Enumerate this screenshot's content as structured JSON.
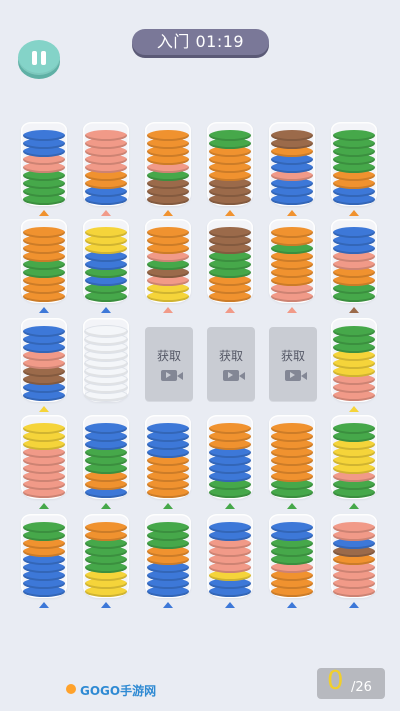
{
  "header": {
    "level_label": "入门 01:19"
  },
  "palette": {
    "blue": "#3d78d8",
    "salmon": "#f19a88",
    "orange": "#f0922f",
    "green": "#46a84a",
    "brown": "#9b6a4a",
    "yellow": "#f5d43a",
    "white": "#f4f6f9"
  },
  "tubes": [
    {
      "col": 0,
      "row": 0,
      "marker": "orange",
      "discs": [
        "blue",
        "blue",
        "blue",
        "salmon",
        "salmon",
        "green",
        "green",
        "green",
        "green"
      ]
    },
    {
      "col": 1,
      "row": 0,
      "marker": "salmon",
      "discs": [
        "salmon",
        "salmon",
        "salmon",
        "salmon",
        "salmon",
        "orange",
        "orange",
        "blue",
        "blue"
      ]
    },
    {
      "col": 2,
      "row": 0,
      "marker": "orange",
      "discs": [
        "orange",
        "orange",
        "orange",
        "orange",
        "salmon",
        "green",
        "brown",
        "brown",
        "brown"
      ]
    },
    {
      "col": 3,
      "row": 0,
      "marker": "orange",
      "discs": [
        "green",
        "green",
        "orange",
        "orange",
        "orange",
        "orange",
        "brown",
        "brown",
        "brown"
      ]
    },
    {
      "col": 4,
      "row": 0,
      "marker": "orange",
      "discs": [
        "brown",
        "brown",
        "orange",
        "blue",
        "blue",
        "salmon",
        "blue",
        "blue",
        "blue"
      ]
    },
    {
      "col": 5,
      "row": 0,
      "marker": "orange",
      "discs": [
        "green",
        "green",
        "green",
        "green",
        "green",
        "orange",
        "orange",
        "blue",
        "blue"
      ]
    },
    {
      "col": 0,
      "row": 1,
      "marker": "blue",
      "discs": [
        "orange",
        "orange",
        "orange",
        "orange",
        "green",
        "green",
        "orange",
        "orange",
        "orange"
      ]
    },
    {
      "col": 1,
      "row": 1,
      "marker": "blue",
      "discs": [
        "yellow",
        "yellow",
        "yellow",
        "blue",
        "blue",
        "green",
        "blue",
        "green",
        "green"
      ]
    },
    {
      "col": 2,
      "row": 1,
      "marker": "salmon",
      "discs": [
        "orange",
        "orange",
        "orange",
        "salmon",
        "green",
        "brown",
        "salmon",
        "yellow",
        "yellow"
      ]
    },
    {
      "col": 3,
      "row": 1,
      "marker": "salmon",
      "discs": [
        "brown",
        "brown",
        "brown",
        "green",
        "green",
        "green",
        "orange",
        "orange",
        "orange"
      ]
    },
    {
      "col": 4,
      "row": 1,
      "marker": "salmon",
      "discs": [
        "orange",
        "orange",
        "green",
        "orange",
        "orange",
        "orange",
        "orange",
        "salmon",
        "salmon"
      ]
    },
    {
      "col": 5,
      "row": 1,
      "marker": "brown",
      "discs": [
        "blue",
        "blue",
        "blue",
        "salmon",
        "salmon",
        "orange",
        "orange",
        "green",
        "green"
      ]
    },
    {
      "col": 0,
      "row": 2,
      "marker": "yellow",
      "discs": [
        "blue",
        "blue",
        "blue",
        "salmon",
        "salmon",
        "brown",
        "brown",
        "blue",
        "blue"
      ]
    },
    {
      "col": 1,
      "row": 2,
      "marker": "",
      "discs": [
        "white",
        "white",
        "white",
        "white",
        "white",
        "white",
        "white",
        "white",
        "white"
      ]
    },
    {
      "col": 5,
      "row": 2,
      "marker": "yellow",
      "discs": [
        "green",
        "green",
        "green",
        "yellow",
        "yellow",
        "yellow",
        "salmon",
        "salmon",
        "salmon"
      ]
    },
    {
      "col": 0,
      "row": 3,
      "marker": "green",
      "discs": [
        "yellow",
        "yellow",
        "yellow",
        "salmon",
        "salmon",
        "salmon",
        "salmon",
        "salmon",
        "salmon"
      ]
    },
    {
      "col": 1,
      "row": 3,
      "marker": "green",
      "discs": [
        "blue",
        "blue",
        "blue",
        "green",
        "green",
        "green",
        "orange",
        "orange",
        "blue"
      ]
    },
    {
      "col": 2,
      "row": 3,
      "marker": "green",
      "discs": [
        "blue",
        "blue",
        "blue",
        "blue",
        "orange",
        "orange",
        "orange",
        "orange",
        "orange"
      ]
    },
    {
      "col": 3,
      "row": 3,
      "marker": "green",
      "discs": [
        "orange",
        "orange",
        "orange",
        "blue",
        "blue",
        "blue",
        "blue",
        "green",
        "green"
      ]
    },
    {
      "col": 4,
      "row": 3,
      "marker": "green",
      "discs": [
        "orange",
        "orange",
        "orange",
        "orange",
        "orange",
        "orange",
        "orange",
        "green",
        "green"
      ]
    },
    {
      "col": 5,
      "row": 3,
      "marker": "green",
      "discs": [
        "green",
        "green",
        "yellow",
        "yellow",
        "yellow",
        "yellow",
        "salmon",
        "green",
        "green"
      ]
    },
    {
      "col": 0,
      "row": 4,
      "marker": "blue",
      "discs": [
        "green",
        "green",
        "orange",
        "orange",
        "blue",
        "blue",
        "blue",
        "blue",
        "blue"
      ]
    },
    {
      "col": 1,
      "row": 4,
      "marker": "blue",
      "discs": [
        "orange",
        "orange",
        "green",
        "green",
        "green",
        "green",
        "yellow",
        "yellow",
        "yellow"
      ]
    },
    {
      "col": 2,
      "row": 4,
      "marker": "blue",
      "discs": [
        "green",
        "green",
        "green",
        "orange",
        "orange",
        "blue",
        "blue",
        "blue",
        "blue"
      ]
    },
    {
      "col": 3,
      "row": 4,
      "marker": "blue",
      "discs": [
        "blue",
        "blue",
        "salmon",
        "salmon",
        "salmon",
        "salmon",
        "yellow",
        "blue",
        "blue"
      ]
    },
    {
      "col": 4,
      "row": 4,
      "marker": "blue",
      "discs": [
        "blue",
        "blue",
        "green",
        "green",
        "green",
        "salmon",
        "orange",
        "orange",
        "orange"
      ]
    },
    {
      "col": 5,
      "row": 4,
      "marker": "blue",
      "discs": [
        "salmon",
        "salmon",
        "blue",
        "brown",
        "orange",
        "salmon",
        "salmon",
        "salmon",
        "salmon"
      ]
    }
  ],
  "locked_slots": [
    {
      "col": 2,
      "row": 2,
      "label": "获取",
      "icon": "video-camera-icon"
    },
    {
      "col": 3,
      "row": 2,
      "label": "获取",
      "icon": "video-camera-icon"
    },
    {
      "col": 4,
      "row": 2,
      "label": "获取",
      "icon": "video-camera-icon"
    }
  ],
  "counter": {
    "current": "0",
    "total": "/26"
  },
  "watermark": {
    "text": "GOGO手游网"
  }
}
